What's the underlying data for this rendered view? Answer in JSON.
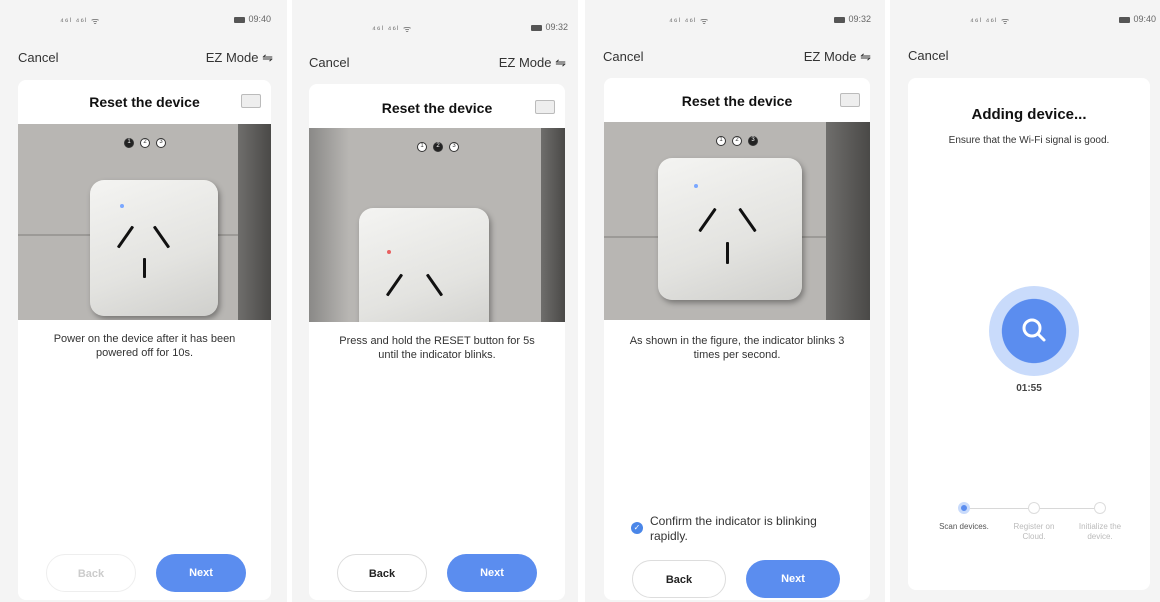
{
  "screens": [
    {
      "status": {
        "signal": "⁴⁶ˡ ⁴⁶ˡ ᯤ",
        "time": "09:40"
      },
      "cancel": "Cancel",
      "mode": "EZ Mode ⇋",
      "title": "Reset the device",
      "steps": [
        "1",
        "2",
        "3"
      ],
      "active_step": 1,
      "description": "Power on the device after it has been powered off for 10s.",
      "back": "Back",
      "next": "Next"
    },
    {
      "status": {
        "signal": "⁴⁶ˡ ⁴⁶ˡ ᯤ",
        "time": "09:32"
      },
      "cancel": "Cancel",
      "mode": "EZ Mode ⇋",
      "title": "Reset the device",
      "steps": [
        "1",
        "2",
        "3"
      ],
      "active_step": 2,
      "description": "Press and hold the RESET button for 5s until the indicator blinks.",
      "back": "Back",
      "next": "Next"
    },
    {
      "status": {
        "signal": "⁴⁶ˡ ⁴⁶ˡ ᯤ",
        "time": "09:32"
      },
      "cancel": "Cancel",
      "mode": "EZ Mode ⇋",
      "title": "Reset the device",
      "steps": [
        "1",
        "2",
        "3"
      ],
      "active_step": 3,
      "description": "As shown in the figure, the indicator blinks 3 times per second.",
      "confirm": "Confirm the indicator is blinking rapidly.",
      "back": "Back",
      "next": "Next"
    },
    {
      "status": {
        "signal": "⁴⁶ˡ ⁴⁶ˡ ᯤ",
        "time": "09:40"
      },
      "cancel": "Cancel",
      "title": "Adding device...",
      "subtitle": "Ensure that the Wi-Fi signal is good.",
      "timer": "01:55",
      "progress_steps": [
        "Scan devices.",
        "Register on Cloud.",
        "Initialize the device."
      ],
      "current_progress_step": 1
    }
  ],
  "colors": {
    "accent": "#5b8def",
    "led_blue": "#7aa7ff",
    "led_red": "#e86060"
  }
}
